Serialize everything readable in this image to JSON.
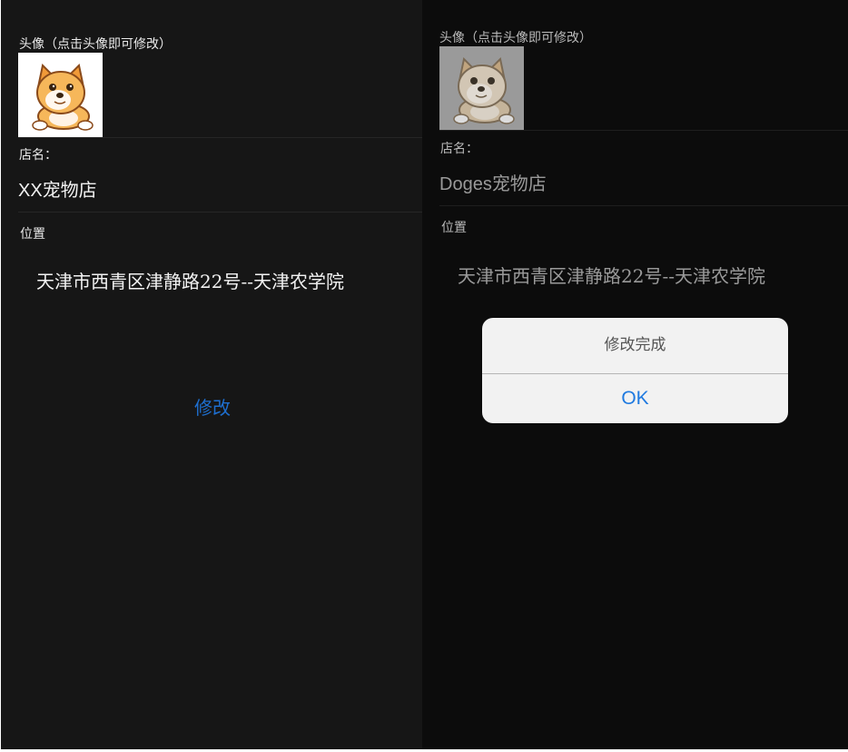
{
  "left": {
    "avatar_label": "头像（点击头像即可修改）",
    "avatar_icon": "shiba-dog-icon",
    "shop_name_label": "店名：",
    "shop_name": "XX宠物店",
    "location_label": "位置",
    "address": "天津市西青区津静路22号--天津农学院",
    "modify_button": "修改"
  },
  "right": {
    "avatar_label": "头像（点击头像即可修改）",
    "avatar_icon": "shiba-dog-icon",
    "shop_name_label": "店名：",
    "shop_name": "Doges宠物店",
    "location_label": "位置",
    "address": "天津市西青区津静路22号--天津农学院",
    "dialog": {
      "message": "修改完成",
      "ok_label": "OK"
    }
  },
  "colors": {
    "accent": "#1e6fd0",
    "dialog_ok": "#1f7ae0"
  }
}
